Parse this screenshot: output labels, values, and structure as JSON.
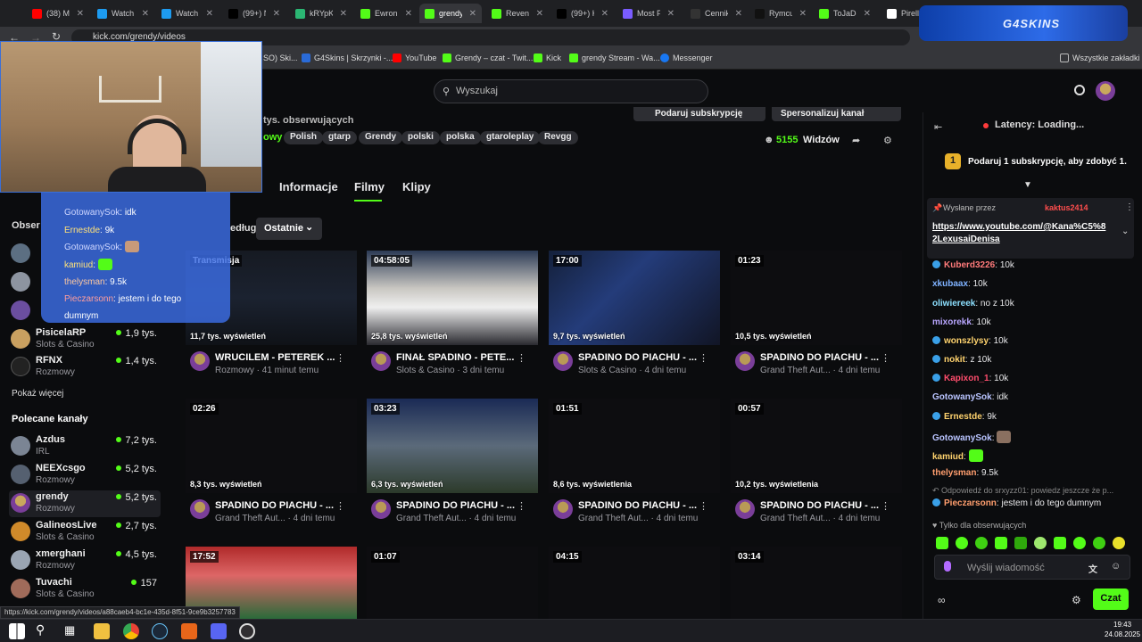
{
  "browser": {
    "tabs": [
      {
        "label": "(38) M",
        "color": "#ff0000",
        "active": false
      },
      {
        "label": "Watch",
        "color": "#1d9bf0",
        "active": false
      },
      {
        "label": "Watch",
        "color": "#1d9bf0",
        "active": false
      },
      {
        "label": "(99+) N",
        "color": "#000000",
        "active": false
      },
      {
        "label": "kRYpK",
        "color": "#2bb673",
        "active": false
      },
      {
        "label": "Ewron",
        "color": "#53fc18",
        "active": false
      },
      {
        "label": "grendy",
        "color": "#53fc18",
        "active": true
      },
      {
        "label": "Revenu",
        "color": "#53fc18",
        "active": false
      },
      {
        "label": "(99+) K",
        "color": "#000000",
        "active": false
      },
      {
        "label": "Most P",
        "color": "#7a5cff",
        "active": false
      },
      {
        "label": "Cennik",
        "color": "#333333",
        "active": false
      },
      {
        "label": "Rymcu",
        "color": "#111111",
        "active": false
      },
      {
        "label": "ToJaDe",
        "color": "#53fc18",
        "active": false
      },
      {
        "label": "Pirelli",
        "color": "#ffffff",
        "active": false
      }
    ],
    "url": "kick.com/grendy/videos",
    "bookmarks": [
      "SO) Ski...",
      "G4Skins | Skrzynki -...",
      "YouTube",
      "Grendy – czat - Twit...",
      "Kick",
      "grendy Stream - Wa...",
      "Messenger"
    ],
    "all_bookmarks": "Wszystkie zakładki",
    "status_url": "https://kick.com/grendy/videos/a88caeb4-bc1e-435d-8f51-9ce9b3257783"
  },
  "overlay": {
    "brand": "G4SKINS"
  },
  "header": {
    "search_placeholder": "Wyszukaj"
  },
  "channel": {
    "followers_text": "tys. obserwujących",
    "category_prefix": "owy",
    "tags": [
      "Polish",
      "gtarp",
      "Grendy",
      "polski",
      "polska",
      "gtaroleplay",
      "Revgg"
    ],
    "viewers": "5155",
    "viewers_label": "Widzów",
    "gift_button": "Podaruj subskrypcję",
    "manage_button": "Spersonalizuj kanał"
  },
  "tabs": [
    "Informacje",
    "Filmy",
    "Klipy"
  ],
  "active_tab": "Filmy",
  "sort": {
    "label": "edług:",
    "value": "Ostatnie"
  },
  "sidebar": {
    "followed_heading": "Obser",
    "followed": [
      {
        "name": "PisicelaRP",
        "category": "Slots & Casino",
        "viewers": "1,9 tys."
      },
      {
        "name": "RFNX",
        "category": "Rozmowy",
        "viewers": "1,4 tys."
      }
    ],
    "show_more": "Pokaż więcej",
    "recommended_heading": "Polecane kanały",
    "recommended": [
      {
        "name": "Azdus",
        "category": "IRL",
        "viewers": "7,2 tys."
      },
      {
        "name": "NEEXcsgo",
        "category": "Rozmowy",
        "viewers": "5,2 tys."
      },
      {
        "name": "grendy",
        "category": "Rozmowy",
        "viewers": "5,2 tys."
      },
      {
        "name": "GalineosLive",
        "category": "Slots & Casino",
        "viewers": "2,7 tys."
      },
      {
        "name": "xmerghani",
        "category": "Rozmowy",
        "viewers": "4,5 tys."
      },
      {
        "name": "Tuvachi",
        "category": "Slots & Casino",
        "viewers": "157"
      }
    ]
  },
  "videos": [
    {
      "duration": "",
      "badge": "Transmisja",
      "views": "11,7 tys. wyświetleń",
      "title": "WRUCILEM - PETEREK ...",
      "meta": "Rozmowy · 41 minut temu"
    },
    {
      "duration": "04:58:05",
      "badge": "",
      "views": "25,8 tys. wyświetleń",
      "title": "FINAŁ SPADINO - PETE...",
      "meta": "Slots & Casino · 3 dni temu"
    },
    {
      "duration": "17:00",
      "badge": "",
      "views": "9,7 tys. wyświetleń",
      "title": "SPADINO DO PIACHU - ...",
      "meta": "Slots & Casino · 4 dni temu"
    },
    {
      "duration": "01:23",
      "badge": "",
      "views": "10,5 tys. wyświetleń",
      "title": "SPADINO DO PIACHU - ...",
      "meta": "Grand Theft Aut... · 4 dni temu"
    },
    {
      "duration": "02:26",
      "badge": "",
      "views": "8,3 tys. wyświetleń",
      "title": "SPADINO DO PIACHU - ...",
      "meta": "Grand Theft Aut... · 4 dni temu"
    },
    {
      "duration": "03:23",
      "badge": "",
      "views": "6,3 tys. wyświetleń",
      "title": "SPADINO DO PIACHU - ...",
      "meta": "Grand Theft Aut... · 4 dni temu"
    },
    {
      "duration": "01:51",
      "badge": "",
      "views": "8,6 tys. wyświetlenia",
      "title": "SPADINO DO PIACHU - ...",
      "meta": "Grand Theft Aut... · 4 dni temu"
    },
    {
      "duration": "00:57",
      "badge": "",
      "views": "10,2 tys. wyświetlenia",
      "title": "SPADINO DO PIACHU - ...",
      "meta": "Grand Theft Aut... · 4 dni temu"
    },
    {
      "duration": "17:52",
      "badge": "",
      "views": "",
      "title": "",
      "meta": ""
    },
    {
      "duration": "01:07",
      "badge": "",
      "views": "",
      "title": "",
      "meta": ""
    },
    {
      "duration": "04:15",
      "badge": "",
      "views": "",
      "title": "",
      "meta": ""
    },
    {
      "duration": "03:14",
      "badge": "",
      "views": "",
      "title": "",
      "meta": ""
    }
  ],
  "chat": {
    "latency": "Latency: Loading...",
    "gift_prompt": "Podaruj 1 subskrypcję, aby zdobyć 1.",
    "pinned_by": "Wysłane przez",
    "pinned_user": "kaktus2414",
    "pinned_link": "https://www.youtube.com/@Kana%C5%82LexusaiDenisa",
    "messages": [
      {
        "user": "Kuberd3226",
        "text": "10k",
        "color": "#ff7b7b"
      },
      {
        "user": "xkubaax",
        "text": "10k",
        "color": "#7fb2ff"
      },
      {
        "user": "oliwiereek",
        "text": "no z 10k",
        "color": "#8de0ff"
      },
      {
        "user": "mixorekk",
        "text": "10k",
        "color": "#b9a6ff"
      },
      {
        "user": "wonszlysy",
        "text": "10k",
        "color": "#ffd36e"
      },
      {
        "user": "nokit",
        "text": "z 10k",
        "color": "#ffd36e"
      },
      {
        "user": "Kapixon_1",
        "text": "10k",
        "color": "#ff4d6d"
      },
      {
        "user": "GotowanySok",
        "text": "idk",
        "color": "#b9c4ff"
      },
      {
        "user": "Ernestde",
        "text": "9k",
        "color": "#ffd36e"
      },
      {
        "user": "GotowanySok",
        "text": "",
        "color": "#b9c4ff"
      },
      {
        "user": "kamiud",
        "text": "",
        "color": "#ffd36e"
      },
      {
        "user": "thelysman",
        "text": "9.5k",
        "color": "#ff9e6e"
      }
    ],
    "reply_to": "Odpowiedź do srxyzz01: powiedz jeszcze że p...",
    "last_user": "Pieczarsonn",
    "last_text": "jestem i do tego dumnym",
    "followers_only": "Tylko dla obserwujących",
    "input_placeholder": "Wyślij wiadomość",
    "send_button": "Czat"
  },
  "overlay_chat": [
    {
      "user": "GotowanySok",
      "text": "idk"
    },
    {
      "user": "Ernestde",
      "text": "9k"
    },
    {
      "user": "GotowanySok",
      "text": ""
    },
    {
      "user": "kamiud",
      "text": ""
    },
    {
      "user": "thelysman",
      "text": "9.5k"
    },
    {
      "user": "Pieczarsonn",
      "text": "jestem i do tego dumnym"
    }
  ],
  "clock": {
    "time": "19:43",
    "date": "24.08.2025"
  }
}
